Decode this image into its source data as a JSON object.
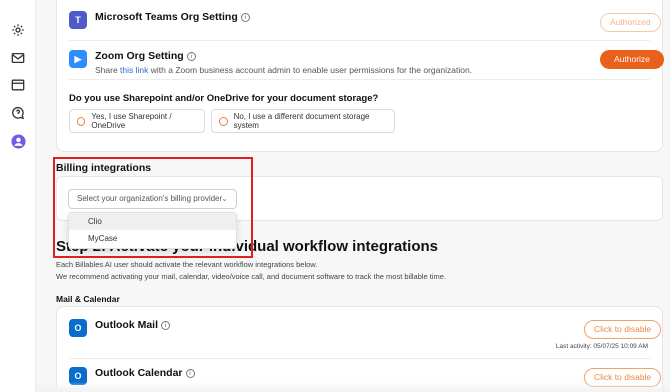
{
  "rail": {
    "icons": [
      "gear-icon",
      "mail-icon",
      "window-icon",
      "chat-help-icon",
      "user-avatar-icon"
    ]
  },
  "integrations": {
    "teams": {
      "name": "Microsoft Teams Org Setting",
      "button": "Authorized"
    },
    "zoom": {
      "name": "Zoom Org Setting",
      "desc_pre": "Share ",
      "desc_link": "this link",
      "desc_post": " with a Zoom business account admin to enable user permissions for the organization.",
      "button": "Authorize"
    }
  },
  "sharepoint": {
    "question": "Do you use Sharepoint and/or OneDrive for your document storage?",
    "option_yes": "Yes, I use Sharepoint / OneDrive",
    "option_no": "No, I use a different document storage system"
  },
  "billing": {
    "title": "Billing integrations",
    "placeholder": "Select your organization's billing provider",
    "options": [
      "Clio",
      "MyCase"
    ]
  },
  "step2": {
    "heading": "Step 2: Activate your individual workflow integrations",
    "line1": "Each Billables AI user should activate the relevant workflow integrations below.",
    "line2": "We recommend activating your mail, calendar, video/voice call, and document software to track the most billable time."
  },
  "mail_calendar": {
    "title": "Mail & Calendar",
    "outlook_mail": {
      "name": "Outlook Mail",
      "button": "Click to disable",
      "last_activity": "Last activity: 05/07/25 10:09 AM"
    },
    "outlook_calendar": {
      "name": "Outlook Calendar",
      "button": "Click to disable"
    }
  },
  "colors": {
    "accent": "#e8601a",
    "highlight_box": "#e0201c",
    "link": "#2d6bd6"
  }
}
